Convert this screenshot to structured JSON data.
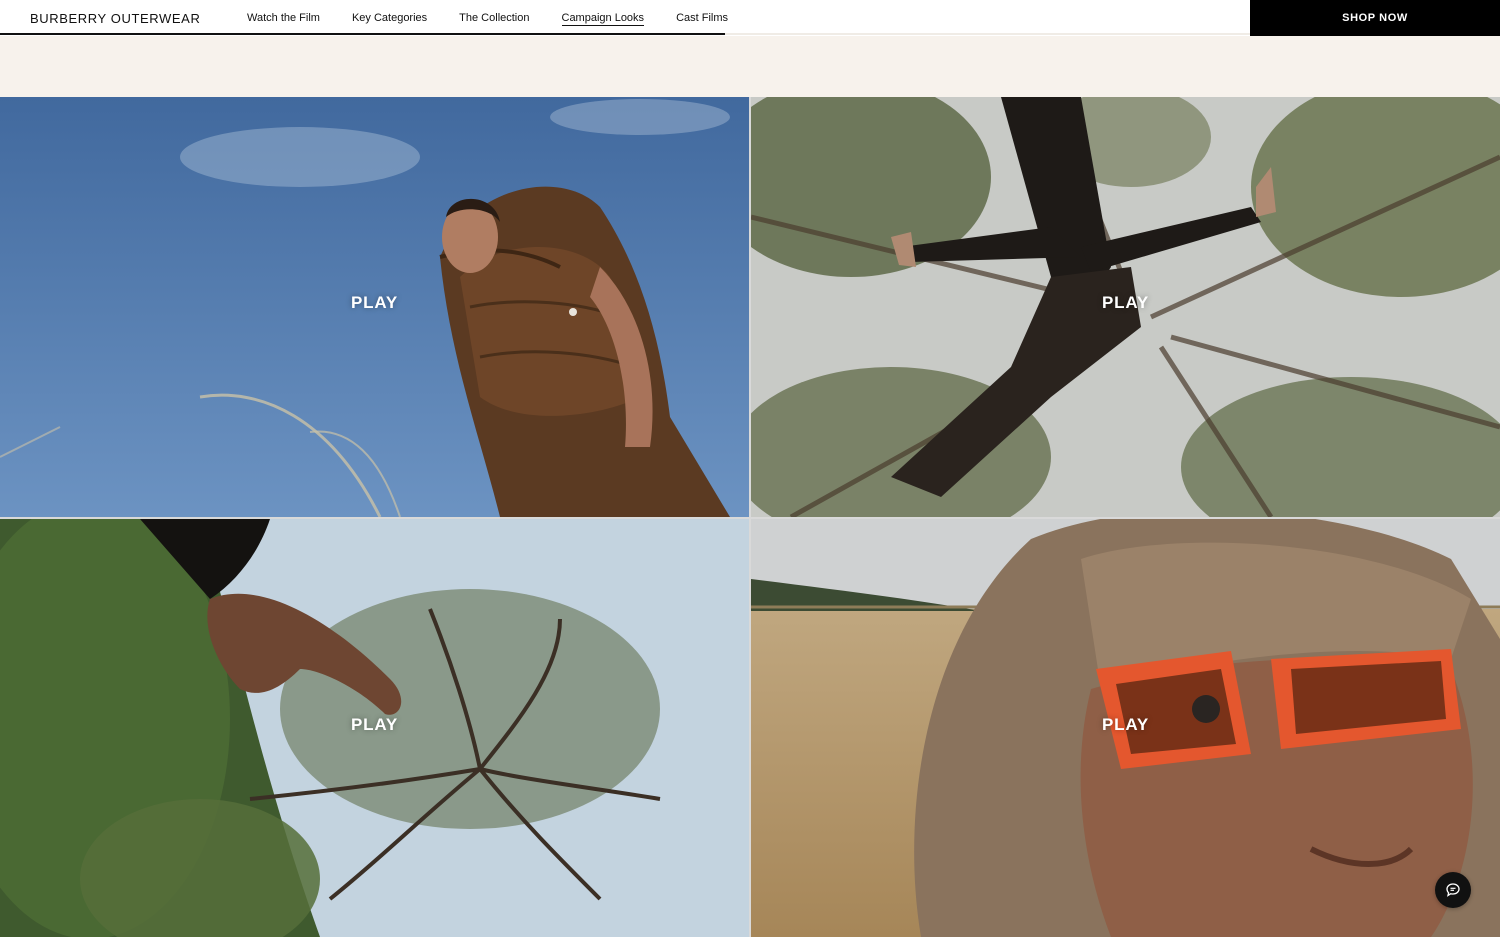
{
  "header": {
    "brand": "BURBERRY OUTERWEAR",
    "nav": [
      {
        "label": "Watch the Film",
        "active": false
      },
      {
        "label": "Key Categories",
        "active": false
      },
      {
        "label": "The Collection",
        "active": false
      },
      {
        "label": "Campaign Looks",
        "active": true
      },
      {
        "label": "Cast Films",
        "active": false
      }
    ],
    "scroll_progress_percent": 58,
    "shop_label": "SHOP NOW"
  },
  "tiles": [
    {
      "play_label": "PLAY",
      "scene": "man-in-brown-puffer-gilet-against-blue-sky"
    },
    {
      "play_label": "PLAY",
      "scene": "figure-leaping-under-tree-canopy"
    },
    {
      "play_label": "PLAY",
      "scene": "hand-reaching-toward-tree"
    },
    {
      "play_label": "PLAY",
      "scene": "hooded-face-with-orange-sunglasses-in-wheat-field"
    }
  ],
  "chat": {
    "icon": "chat-bubble-icon"
  },
  "colors": {
    "accent_black": "#000000",
    "page_background": "#f7f2ec",
    "sky_blue": "#4f79ad",
    "sunglasses_orange": "#e4572e"
  }
}
